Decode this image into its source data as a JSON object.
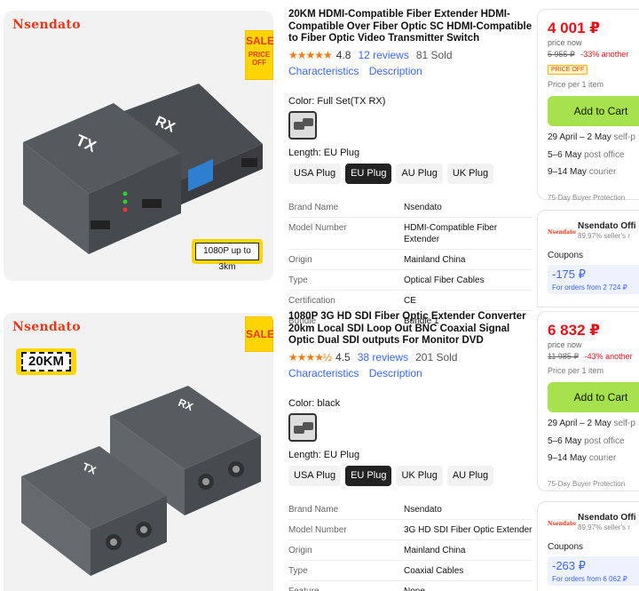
{
  "products": [
    {
      "brand_logo": "Nsendato",
      "sale": "SALE",
      "price_off": "PRICE OFF",
      "image_badge": "1080P up to 3km",
      "title": "20KM HDMI-Compatible Fiber Extender HDMI-Compatible Over Fiber Optic SC HDMI-Compatible to Fiber Optic Video Transmitter Switch",
      "stars": "★★★★★",
      "rating": "4.8",
      "reviews": "12 reviews",
      "sold": "81 Sold",
      "link_characteristics": "Characteristics",
      "link_description": "Description",
      "color_label": "Color: Full Set(TX RX)",
      "length_label": "Length: EU Plug",
      "plugs": [
        "USA Plug",
        "EU Plug",
        "AU Plug",
        "UK Plug"
      ],
      "selected_plug": "EU Plug",
      "specs": [
        {
          "k": "Brand Name",
          "v": "Nsendato"
        },
        {
          "k": "Model Number",
          "v": "HDMI-Compatible Fiber Extender"
        },
        {
          "k": "Origin",
          "v": "Mainland China"
        },
        {
          "k": "Type",
          "v": "Optical Fiber Cables"
        },
        {
          "k": "Certification",
          "v": "CE"
        },
        {
          "k": "Bundle",
          "v": "Bundle 1"
        }
      ],
      "price": "4 001 ₽",
      "price_now": "price now",
      "old_price": "5 955 ₽",
      "discount": "-33% another",
      "price_off_badge": "PRICE OFF",
      "per_item": "Price per 1 item",
      "add_to_cart": "Add to Cart",
      "delivery": [
        {
          "date": "29 April – 2 May",
          "method": "self-p"
        },
        {
          "date": "5–6 May",
          "method": "post office"
        },
        {
          "date": "9–14 May",
          "method": "courier"
        }
      ],
      "protection": "75-Day Buyer Protection",
      "seller_logo": "Nsendato",
      "seller_name": "Nsendato Offi",
      "seller_positive": "89,97% seller's r",
      "coupons_label": "Coupons",
      "coupon_amount": "-175 ₽",
      "coupon_condition": "For orders from 2 724 ₽"
    },
    {
      "brand_logo": "Nsendato",
      "sale": "SALE",
      "image_badge": "20KM",
      "title": "1080P 3G HD SDI Fiber Optic Extender Converter 20km Local SDI Loop Out BNC Coaxial Signal Optic Dual SDI outputs For Monitor DVD",
      "stars": "★★★★½",
      "rating": "4.5",
      "reviews": "38 reviews",
      "sold": "201 Sold",
      "link_characteristics": "Characteristics",
      "link_description": "Description",
      "color_label": "Color: black",
      "length_label": "Length: EU Plug",
      "plugs": [
        "USA Plug",
        "EU Plug",
        "UK Plug",
        "AU Plug"
      ],
      "selected_plug": "EU Plug",
      "specs": [
        {
          "k": "Brand Name",
          "v": "Nsendato"
        },
        {
          "k": "Model Number",
          "v": "3G HD SDI Fiber Optic Extender"
        },
        {
          "k": "Origin",
          "v": "Mainland China"
        },
        {
          "k": "Type",
          "v": "Coaxial Cables"
        },
        {
          "k": "Feature",
          "v": "None"
        }
      ],
      "price": "6 832 ₽",
      "price_now": "price now",
      "old_price": "11 985 ₽",
      "discount": "-43% another",
      "per_item": "Price per 1 item",
      "add_to_cart": "Add to Cart",
      "delivery": [
        {
          "date": "29 April – 2 May",
          "method": "self-p"
        },
        {
          "date": "5–6 May",
          "method": "post office"
        },
        {
          "date": "9–14 May",
          "method": "courier"
        }
      ],
      "protection": "75-Day Buyer Protection",
      "seller_logo": "Nsendato",
      "seller_name": "Nsendato Offi",
      "seller_positive": "89,97% seller's r",
      "coupons_label": "Coupons",
      "coupon_amount": "-263 ₽",
      "coupon_condition": "For orders from 6 062 ₽"
    }
  ],
  "colors": {
    "price_red": "#e3131b",
    "link_blue": "#3d66ff",
    "cart_green": "#a6e24e",
    "star_orange": "#f07a13",
    "sale_yellow": "#ffd500"
  }
}
